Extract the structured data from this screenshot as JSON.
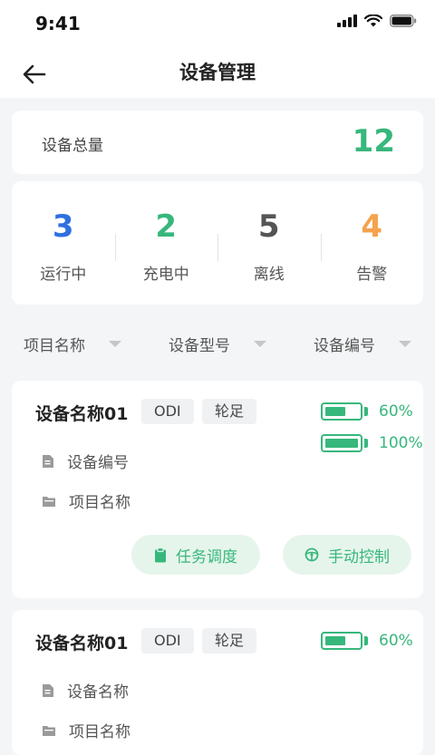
{
  "status_bar": {
    "time": "9:41"
  },
  "header": {
    "title": "设备管理"
  },
  "summary": {
    "label": "设备总量",
    "value": "12"
  },
  "stats": [
    {
      "value": "3",
      "label": "运行中",
      "color": "#2f6fe0"
    },
    {
      "value": "2",
      "label": "充电中",
      "color": "#37b77c"
    },
    {
      "value": "5",
      "label": "离线",
      "color": "#555555"
    },
    {
      "value": "4",
      "label": "告警",
      "color": "#f5a24d"
    }
  ],
  "filters": [
    {
      "label": "项目名称"
    },
    {
      "label": "设备型号"
    },
    {
      "label": "设备编号"
    }
  ],
  "devices": [
    {
      "name": "设备名称01",
      "tags": [
        "ODI",
        "轮足"
      ],
      "batteries": [
        {
          "percent_label": "60%",
          "level": 0.6
        },
        {
          "percent_label": "100%",
          "level": 1.0
        }
      ],
      "info": [
        {
          "icon": "document-icon",
          "label": "设备编号"
        },
        {
          "icon": "folder-icon",
          "label": "项目名称"
        }
      ],
      "actions": [
        {
          "icon": "clipboard-icon",
          "label": "任务调度"
        },
        {
          "icon": "steering-wheel-icon",
          "label": "手动控制"
        }
      ]
    },
    {
      "name": "设备名称01",
      "tags": [
        "ODI",
        "轮足"
      ],
      "batteries": [
        {
          "percent_label": "60%",
          "level": 0.6
        }
      ],
      "info": [
        {
          "icon": "document-icon",
          "label": "设备名称"
        },
        {
          "icon": "folder-icon",
          "label": "项目名称"
        }
      ]
    }
  ],
  "colors": {
    "accent": "#37b77c",
    "background": "#f4f5f7"
  }
}
